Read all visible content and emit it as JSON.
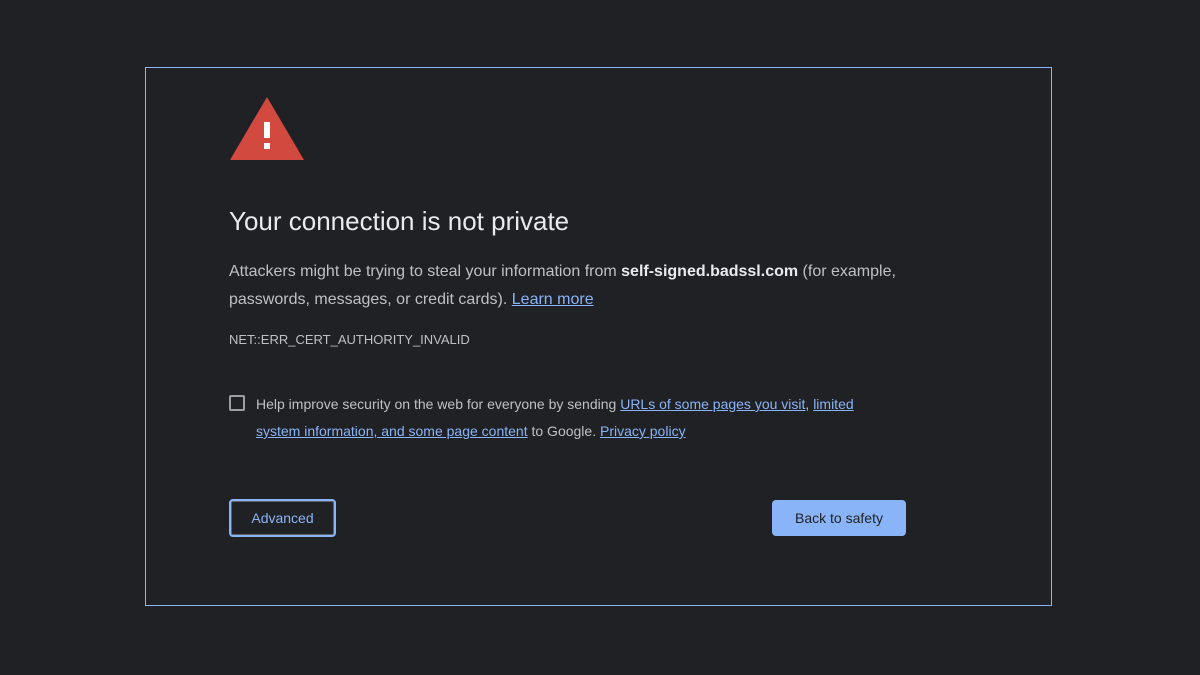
{
  "heading": "Your connection is not private",
  "explanation": {
    "before_host": "Attackers might be trying to steal your information from ",
    "host": "self-signed.badssl.com",
    "after_host": " (for example, passwords, messages, or credit cards). ",
    "learn_more": "Learn more"
  },
  "error_code": "NET::ERR_CERT_AUTHORITY_INVALID",
  "opt_in": {
    "checked": false,
    "text_before": "Help improve security on the web for everyone by sending ",
    "link_urls": "URLs of some pages you visit",
    "comma": ", ",
    "link_system_info": "limited system information, and some page content",
    "text_after": " to Google. ",
    "link_privacy": "Privacy policy"
  },
  "buttons": {
    "advanced": "Advanced",
    "back_to_safety": "Back to safety"
  },
  "icon": {
    "name": "warning-triangle-icon",
    "color": "#d1493f",
    "glyph": "!"
  },
  "colors": {
    "background": "#202124",
    "accent": "#8ab4f8",
    "heading_text": "#e8eaed",
    "body_text": "#bdc1c6"
  }
}
